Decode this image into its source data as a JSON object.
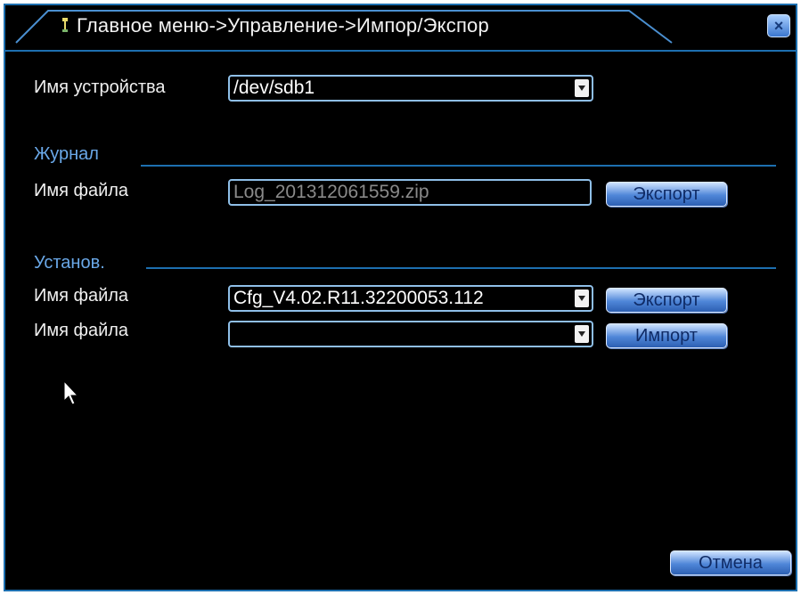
{
  "window": {
    "title": "Главное меню->Управление->Импор/Экспор",
    "close_label": "×"
  },
  "device": {
    "label": "Имя устройства",
    "value": "/dev/sdb1"
  },
  "journal": {
    "section_title": "Журнал",
    "file_label": "Имя файла",
    "file_value": "Log_201312061559.zip",
    "export_label": "Экспорт"
  },
  "settings": {
    "section_title": "Установ.",
    "export_file_label": "Имя файла",
    "export_file_value": "Cfg_V4.02.R11.32200053.112",
    "export_label": "Экспорт",
    "import_file_label": "Имя файла",
    "import_file_value": "",
    "import_label": "Импорт"
  },
  "footer": {
    "cancel_label": "Отмена"
  }
}
